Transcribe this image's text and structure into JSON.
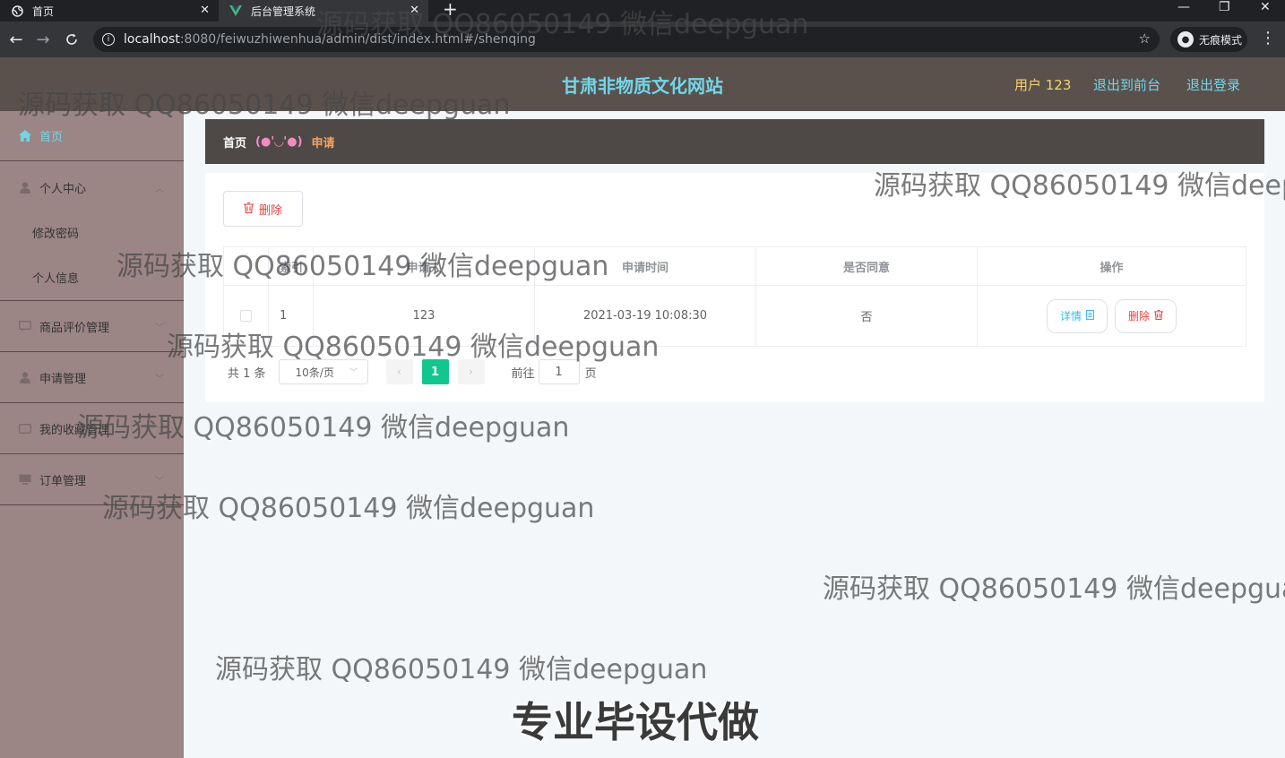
{
  "browser": {
    "tabs": [
      {
        "title": "首页",
        "icon": "globe-icon"
      },
      {
        "title": "后台管理系统",
        "icon": "vue-logo-icon"
      }
    ],
    "new_tab": "+",
    "url_host": "localhost",
    "url_path": ":8080/feiwuzhiwenhua/admin/dist/index.html#/shenqing",
    "incognito_label": "无痕模式"
  },
  "header": {
    "title": "甘肃非物质文化网站",
    "user": "用户 123",
    "front_link": "退出到前台",
    "logout_link": "退出登录"
  },
  "sidebar": {
    "items": [
      {
        "label": "首页",
        "icon": "home-icon"
      },
      {
        "label": "个人中心",
        "icon": "user-icon"
      },
      {
        "label": "修改密码"
      },
      {
        "label": "个人信息"
      },
      {
        "label": "商品评价管理",
        "icon": "comment-icon"
      },
      {
        "label": "申请管理",
        "icon": "user-icon"
      },
      {
        "label": "我的收藏管理",
        "icon": "folder-icon"
      },
      {
        "label": "订单管理",
        "icon": "monitor-icon"
      }
    ]
  },
  "breadcrumb": {
    "home": "首页",
    "separator": "(●'◡'●)",
    "current": "申请"
  },
  "toolbar": {
    "delete_label": "删除"
  },
  "table": {
    "headers": [
      "",
      "索引",
      "申请人",
      "申请时间",
      "是否同意",
      "操作"
    ],
    "rows": [
      {
        "index": "1",
        "applicant": "123",
        "time": "2021-03-19 10:08:30",
        "agree": "否"
      }
    ],
    "detail_label": "详情",
    "delete_label": "删除"
  },
  "pagination": {
    "total": "共 1 条",
    "page_size": "10条/页",
    "current_page": "1",
    "goto_prefix": "前往",
    "goto_value": "1",
    "goto_suffix": "页"
  },
  "watermarks": {
    "text": "源码获取 QQ86050149 微信deepguan",
    "big": "专业毕设代做"
  }
}
